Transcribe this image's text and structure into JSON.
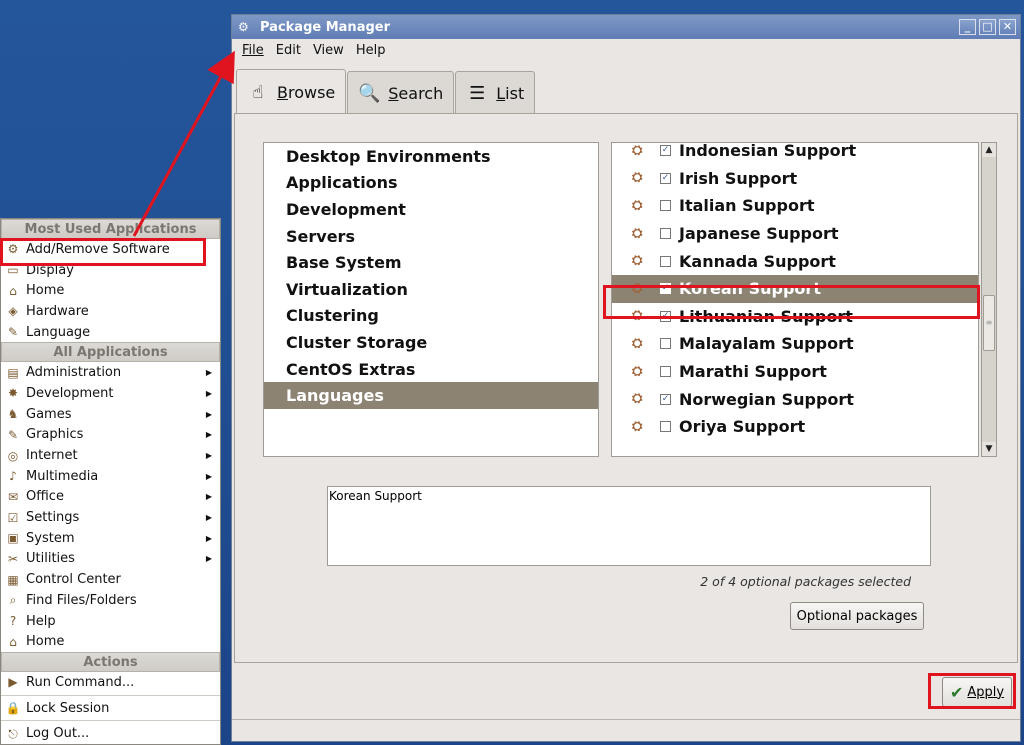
{
  "window": {
    "title": "Package Manager",
    "controls": {
      "minimize": "_",
      "maximize": "□",
      "close": "✕"
    }
  },
  "menubar": [
    "File",
    "Edit",
    "View",
    "Help"
  ],
  "tabs": [
    {
      "label": "Browse",
      "icon": "hand-pointer-icon",
      "active": true
    },
    {
      "label": "Search",
      "icon": "magnifier-icon",
      "active": false
    },
    {
      "label": "List",
      "icon": "list-icon",
      "active": false
    }
  ],
  "categories": [
    {
      "label": "Desktop Environments",
      "selected": false
    },
    {
      "label": "Applications",
      "selected": false
    },
    {
      "label": "Development",
      "selected": false
    },
    {
      "label": "Servers",
      "selected": false
    },
    {
      "label": "Base System",
      "selected": false
    },
    {
      "label": "Virtualization",
      "selected": false
    },
    {
      "label": "Clustering",
      "selected": false
    },
    {
      "label": "Cluster Storage",
      "selected": false
    },
    {
      "label": "CentOS Extras",
      "selected": false
    },
    {
      "label": "Languages",
      "selected": true
    }
  ],
  "packages": [
    {
      "label": "Indonesian Support",
      "checked": true,
      "selected": false
    },
    {
      "label": "Irish Support",
      "checked": true,
      "selected": false
    },
    {
      "label": "Italian Support",
      "checked": false,
      "selected": false
    },
    {
      "label": "Japanese Support",
      "checked": false,
      "selected": false
    },
    {
      "label": "Kannada Support",
      "checked": false,
      "selected": false
    },
    {
      "label": "Korean Support",
      "checked": true,
      "selected": true
    },
    {
      "label": "Lithuanian Support",
      "checked": true,
      "selected": false
    },
    {
      "label": "Malayalam Support",
      "checked": false,
      "selected": false
    },
    {
      "label": "Marathi Support",
      "checked": false,
      "selected": false
    },
    {
      "label": "Norwegian Support",
      "checked": true,
      "selected": false
    },
    {
      "label": "Oriya Support",
      "checked": false,
      "selected": false
    }
  ],
  "description": "Korean Support",
  "optional_info": "2 of 4 optional packages selected",
  "optional_button": "Optional packages",
  "apply_button": "Apply",
  "app_menu": {
    "most_used_header": "Most Used Applications",
    "most_used": [
      {
        "label": "Add/Remove Software",
        "icon": "package-icon"
      },
      {
        "label": "Display",
        "icon": "monitor-icon"
      },
      {
        "label": "Home",
        "icon": "home-icon"
      },
      {
        "label": "Hardware",
        "icon": "hardware-icon"
      },
      {
        "label": "Language",
        "icon": "language-icon"
      }
    ],
    "all_header": "All Applications",
    "all": [
      {
        "label": "Administration",
        "icon": "admin-icon",
        "submenu": true
      },
      {
        "label": "Development",
        "icon": "development-icon",
        "submenu": true
      },
      {
        "label": "Games",
        "icon": "games-icon",
        "submenu": true
      },
      {
        "label": "Graphics",
        "icon": "graphics-icon",
        "submenu": true
      },
      {
        "label": "Internet",
        "icon": "internet-icon",
        "submenu": true
      },
      {
        "label": "Multimedia",
        "icon": "multimedia-icon",
        "submenu": true
      },
      {
        "label": "Office",
        "icon": "office-icon",
        "submenu": true
      },
      {
        "label": "Settings",
        "icon": "settings-icon",
        "submenu": true
      },
      {
        "label": "System",
        "icon": "system-icon",
        "submenu": true
      },
      {
        "label": "Utilities",
        "icon": "utilities-icon",
        "submenu": true
      },
      {
        "label": "Control Center",
        "icon": "control-center-icon",
        "submenu": false
      },
      {
        "label": "Find Files/Folders",
        "icon": "find-icon",
        "submenu": false
      },
      {
        "label": "Help",
        "icon": "help-icon",
        "submenu": false
      },
      {
        "label": "Home",
        "icon": "home-icon",
        "submenu": false
      }
    ],
    "actions_header": "Actions",
    "actions": [
      {
        "label": "Run Command...",
        "icon": "run-icon"
      },
      {
        "label": "Lock Session",
        "icon": "lock-icon"
      },
      {
        "label": "Log Out...",
        "icon": "logout-icon"
      }
    ]
  },
  "annotation_color": "#e0141e"
}
